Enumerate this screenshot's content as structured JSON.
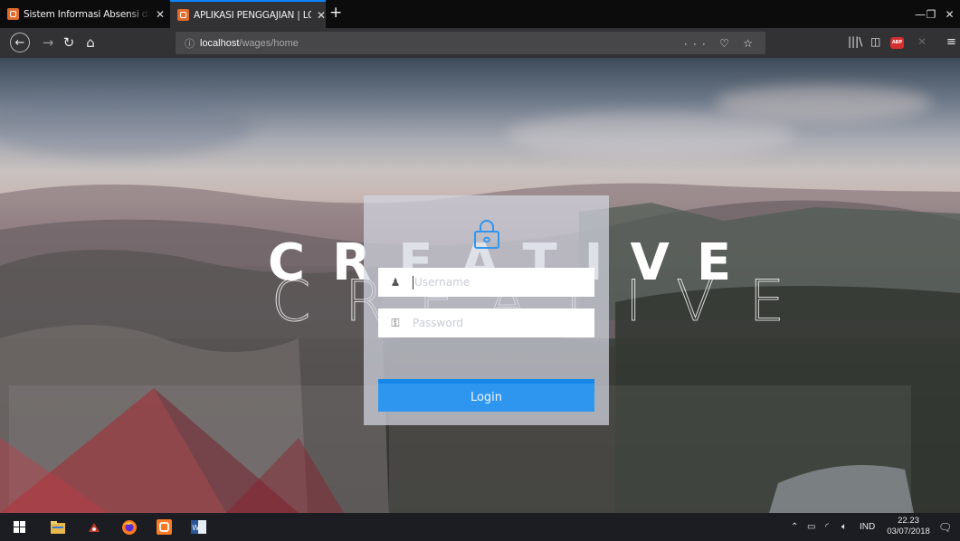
{
  "browser": {
    "tabs": [
      {
        "title": "Sistem Informasi Absensi dan P",
        "active": false
      },
      {
        "title": "APLIKASI PENGGAJIAN | LOGIN",
        "active": true
      }
    ],
    "new_tab": "+",
    "url_host": "localhost",
    "url_path": "/wages/home",
    "url_tools": "··· ♡ ☆"
  },
  "page": {
    "brand": "CREATIVE",
    "login": {
      "username_placeholder": "Username",
      "password_placeholder": "Password",
      "button_label": "Login"
    }
  },
  "taskbar": {
    "language": "IND",
    "time": "22.23",
    "date": "03/07/2018"
  },
  "colors": {
    "accent": "#2f96f0",
    "chrome": "#323234",
    "tab_highlight": "#0a84ff",
    "taskbar": "#1c1d22"
  }
}
